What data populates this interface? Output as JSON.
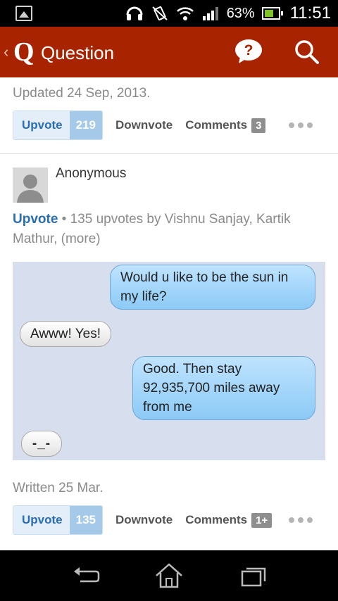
{
  "status_bar": {
    "battery_percent": "63%",
    "time": "11:51",
    "icons": [
      "image-icon",
      "headset-icon",
      "no-vibrate-icon",
      "wifi-icon",
      "signal-icon",
      "battery-icon"
    ]
  },
  "app_bar": {
    "back_chevron": "‹",
    "logo": "Q",
    "title": "Question",
    "help_glyph": "?"
  },
  "question_footer": {
    "updated_text": "Updated 24 Sep, 2013.",
    "upvote_label": "Upvote",
    "upvote_count": "219",
    "downvote_label": "Downvote",
    "comments_label": "Comments",
    "comments_count": "3"
  },
  "answer": {
    "author": "Anonymous",
    "upvote_label": "Upvote",
    "upvote_summary": " • 135 upvotes by Vishnu Sanjay, Kartik Mathur, (more)",
    "chat_image": {
      "messages": [
        {
          "side": "right",
          "text": "Would u like to be the sun in my life?"
        },
        {
          "side": "left",
          "text": "Awww! Yes!"
        },
        {
          "side": "right",
          "text": "Good. Then stay 92,935,700 miles away from me"
        },
        {
          "side": "left",
          "text": "-_-"
        }
      ]
    },
    "written_text": "Written 25 Mar.",
    "footer": {
      "upvote_label": "Upvote",
      "upvote_count": "135",
      "downvote_label": "Downvote",
      "comments_label": "Comments",
      "comments_count": "1+"
    }
  },
  "nav_bar": {
    "icons": [
      "back-icon",
      "home-icon",
      "recents-icon"
    ]
  },
  "colors": {
    "app_bar": "#a82400",
    "link_blue": "#2b6db1",
    "upvote_bg": "#e3eef8",
    "upvote_count_bg": "#a5c9e8"
  }
}
